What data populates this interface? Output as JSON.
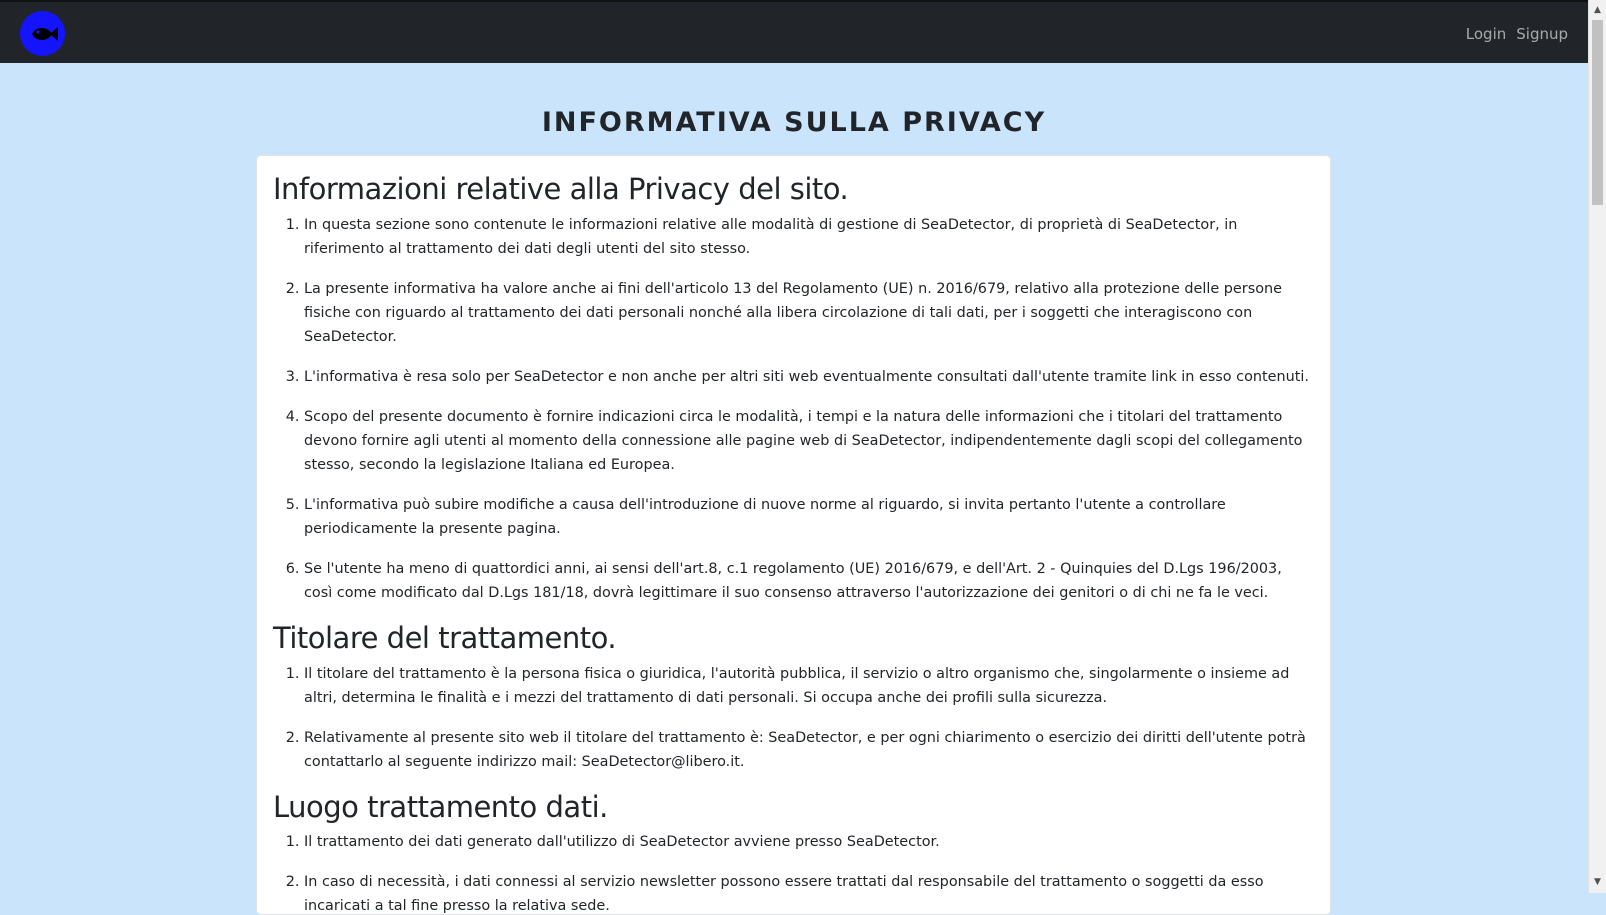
{
  "navbar": {
    "logo_icon": "fish-icon",
    "login_label": "Login",
    "signup_label": "Signup"
  },
  "page_title": "INFORMATIVA SULLA PRIVACY",
  "sections": [
    {
      "heading": "Informazioni relative alla Privacy del sito.",
      "items": [
        "In questa sezione sono contenute le informazioni relative alle modalità di gestione di SeaDetector, di proprietà di SeaDetector, in riferimento al trattamento dei dati degli utenti del sito stesso.",
        "La presente informativa ha valore anche ai fini dell'articolo 13 del Regolamento (UE) n. 2016/679, relativo alla protezione delle persone fisiche con riguardo al trattamento dei dati personali nonché alla libera circolazione di tali dati, per i soggetti che interagiscono con SeaDetector.",
        "L'informativa è resa solo per SeaDetector e non anche per altri siti web eventualmente consultati dall'utente tramite link in esso contenuti.",
        "Scopo del presente documento è fornire indicazioni circa le modalità, i tempi e la natura delle informazioni che i titolari del trattamento devono fornire agli utenti al momento della connessione alle pagine web di SeaDetector, indipendentemente dagli scopi del collegamento stesso, secondo la legislazione Italiana ed Europea.",
        "L'informativa può subire modifiche a causa dell'introduzione di nuove norme al riguardo, si invita pertanto l'utente a controllare periodicamente la presente pagina.",
        "Se l'utente ha meno di quattordici anni, ai sensi dell'art.8, c.1 regolamento (UE) 2016/679, e dell'Art. 2 - Quinquies del D.Lgs 196/2003, così come modificato dal D.Lgs 181/18, dovrà legittimare il suo consenso attraverso l'autorizzazione dei genitori o di chi ne fa le veci."
      ]
    },
    {
      "heading": "Titolare del trattamento.",
      "items": [
        "Il titolare del trattamento è la persona fisica o giuridica, l'autorità pubblica, il servizio o altro organismo che, singolarmente o insieme ad altri, determina le finalità e i mezzi del trattamento di dati personali. Si occupa anche dei profili sulla sicurezza.",
        "Relativamente al presente sito web il titolare del trattamento è: SeaDetector, e per ogni chiarimento o esercizio dei diritti dell'utente potrà contattarlo al seguente indirizzo mail: SeaDetector@libero.it."
      ]
    },
    {
      "heading": "Luogo trattamento dati.",
      "items": [
        "Il trattamento dei dati generato dall'utilizzo di SeaDetector avviene presso SeaDetector.",
        "In caso di necessità, i dati connessi al servizio newsletter possono essere trattati dal responsabile del trattamento o soggetti da esso incaricati a tal fine presso la relativa sede."
      ]
    }
  ]
}
